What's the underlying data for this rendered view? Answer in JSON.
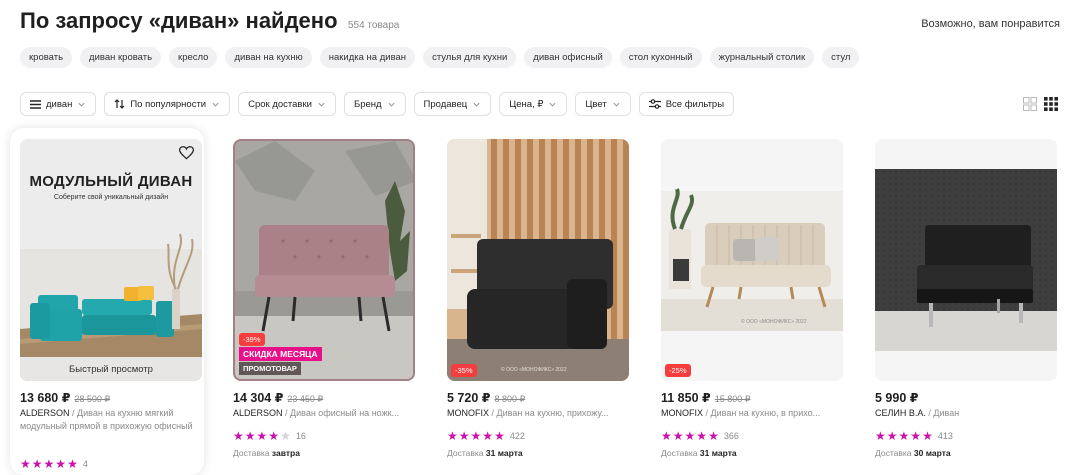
{
  "header": {
    "title": "По запросу «диван» найдено",
    "count": "554 товара",
    "maybe_like": "Возможно, вам понравится"
  },
  "chips": [
    "кровать",
    "диван кровать",
    "кресло",
    "диван на кухню",
    "накидка на диван",
    "стулья для кухни",
    "диван офисный",
    "стол кухонный",
    "журнальный столик",
    "стул"
  ],
  "filters": {
    "category": "диван",
    "sort": "По популярности",
    "delivery": "Срок доставки",
    "brand": "Бренд",
    "seller": "Продавец",
    "price": "Цена, ₽",
    "color": "Цвет",
    "all": "Все фильтры"
  },
  "products": [
    {
      "banner_title": "МОДУЛЬНЫЙ ДИВАН",
      "banner_subtitle": "Соберите свой уникальный дизайн",
      "quick_view": "Быстрый просмотр",
      "price": "13 680 ₽",
      "old_price": "28 500 ₽",
      "brand": "ALDERSON",
      "name": "Диван на кухню мягкий модульный прямой в прихожую офисный",
      "rating": 5,
      "reviews": "4",
      "delivery_label": "",
      "delivery_date": ""
    },
    {
      "discount": "-39%",
      "badge_month": "СКИДКА МЕСЯЦА",
      "badge_promo": "ПРОМОТОВАР",
      "price": "14 304 ₽",
      "old_price": "23 450 ₽",
      "brand": "ALDERSON",
      "name": "Диван офисный на ножк...",
      "rating": 4,
      "reviews": "16",
      "delivery_label": "Доставка",
      "delivery_date": "завтра"
    },
    {
      "discount": "-35%",
      "watermark": "© ООО «МОНОФИКС» 2022",
      "price": "5 720 ₽",
      "old_price": "8 800 ₽",
      "brand": "MONOFIX",
      "name": "Диван на кухню, прихожу...",
      "rating": 5,
      "reviews": "422",
      "delivery_label": "Доставка",
      "delivery_date": "31 марта"
    },
    {
      "discount": "-25%",
      "watermark": "© ООО «МОНОФИКС» 2022",
      "price": "11 850 ₽",
      "old_price": "15 800 ₽",
      "brand": "MONOFIX",
      "name": "Диван на кухню, в прихо...",
      "rating": 5,
      "reviews": "366",
      "delivery_label": "Доставка",
      "delivery_date": "31 марта"
    },
    {
      "price": "5 990 ₽",
      "old_price": "",
      "brand": "СЕЛИН В.А.",
      "name": "Диван",
      "rating": 5,
      "reviews": "413",
      "delivery_label": "Доставка",
      "delivery_date": "30 марта"
    }
  ],
  "colors": {
    "star": "#cb11ab",
    "discount": "#f53d3d",
    "month_badge": "#e8108a",
    "teal_sofa": "#1fa3a8"
  },
  "icons": [
    "menu-icon",
    "sort-icon",
    "chevron-down-icon",
    "sliders-icon",
    "grid-large-icon",
    "grid-small-icon",
    "heart-icon",
    "star-icon"
  ]
}
